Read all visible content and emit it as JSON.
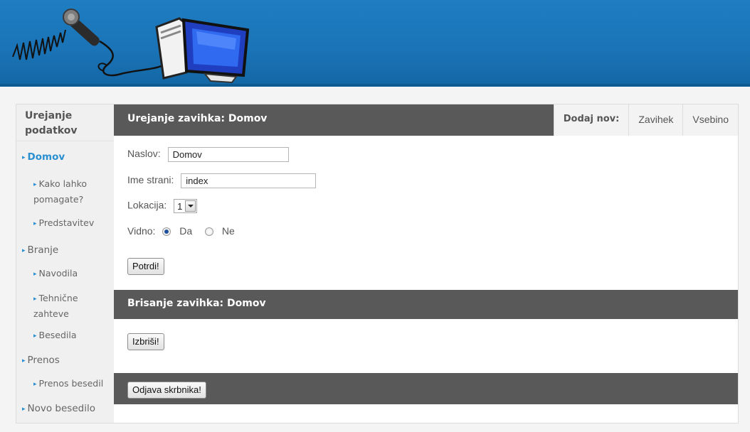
{
  "banner": {
    "logo_icons": [
      "microphone-icon",
      "computer-icon"
    ]
  },
  "sidebar": {
    "title": "Urejanje podatkov",
    "items": [
      {
        "label": "Domov",
        "level": 1,
        "active": true
      },
      {
        "label": "Kako lahko pomagate?",
        "level": 2
      },
      {
        "label": "Predstavitev",
        "level": 2
      },
      {
        "label": "Branje",
        "level": 1
      },
      {
        "label": "Navodila",
        "level": 2
      },
      {
        "label": "Tehnične zahteve",
        "level": 2
      },
      {
        "label": "Besedila",
        "level": 2
      },
      {
        "label": "Prenos",
        "level": 1
      },
      {
        "label": "Prenos besedil",
        "level": 2
      },
      {
        "label": "Novo besedilo",
        "level": 1
      }
    ]
  },
  "edit": {
    "title": "Urejanje zavihka: Domov",
    "tabs": {
      "add_label": "Dodaj nov:",
      "tab1": "Zavihek",
      "tab2": "Vsebino"
    },
    "title_label": "Naslov:",
    "title_value": "Domov",
    "page_label": "Ime strani:",
    "page_value": "index",
    "location_label": "Lokacija:",
    "location_value": "1",
    "visible_label": "Vidno:",
    "visible_yes": "Da",
    "visible_no": "Ne",
    "visible_selected": "Da",
    "submit_label": "Potrdi!"
  },
  "delete": {
    "title": "Brisanje zavihka: Domov",
    "button_label": "Izbriši!"
  },
  "footer": {
    "logout_label": "Odjava skrbnika!"
  },
  "colors": {
    "banner": "#1a73b6",
    "bar": "#595959",
    "accent": "#2a8fd0"
  }
}
